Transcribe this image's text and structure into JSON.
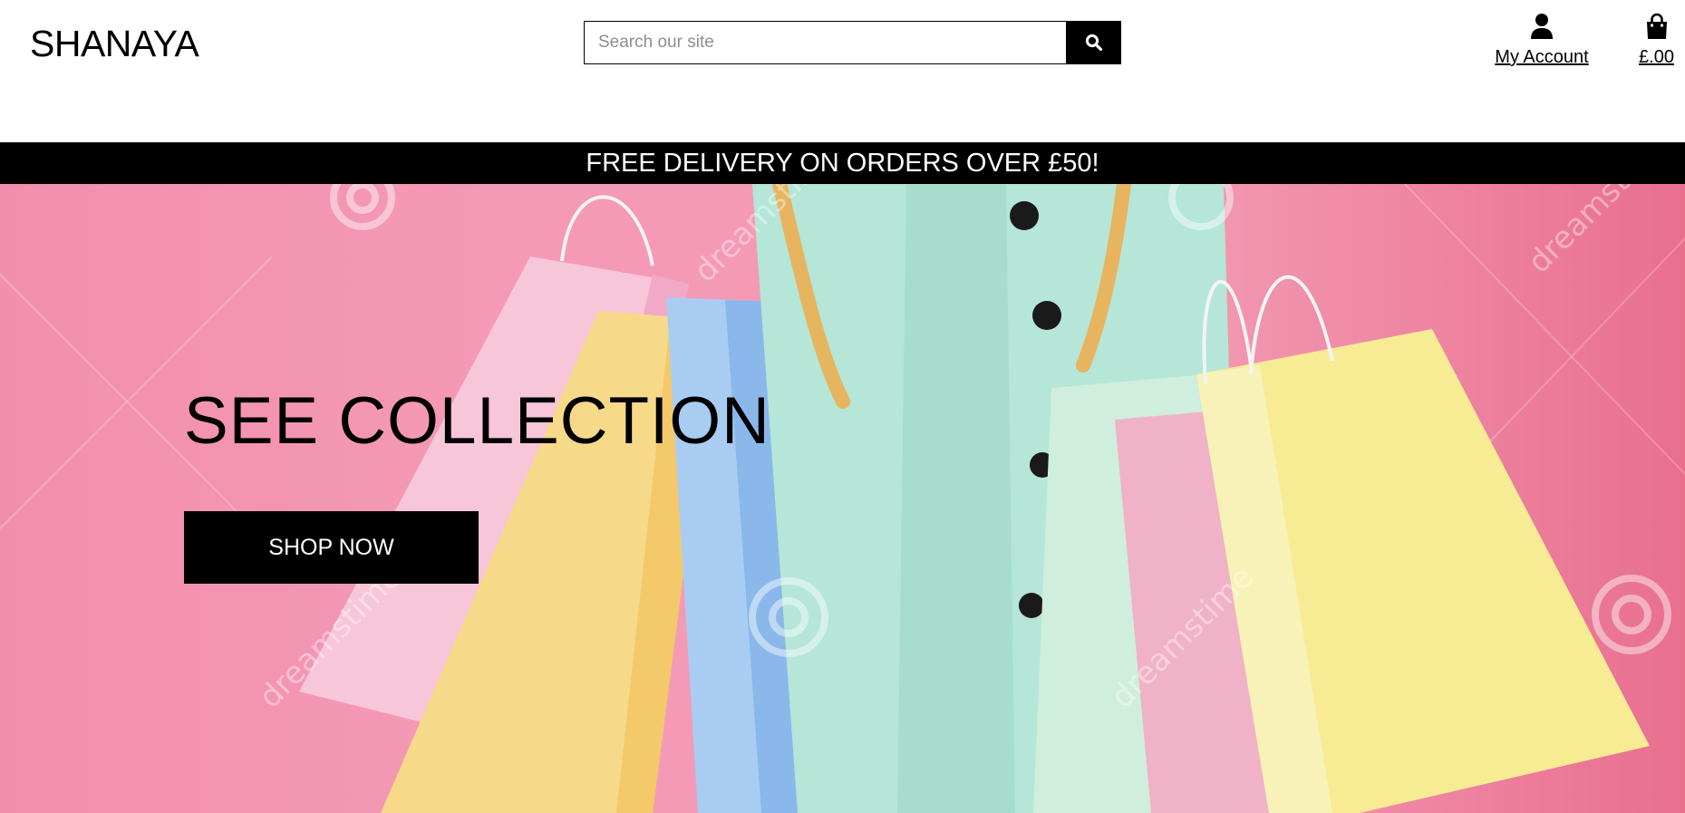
{
  "header": {
    "brand": "SHANAYA",
    "search": {
      "placeholder": "Search our site",
      "value": ""
    },
    "account_label": "My Account",
    "cart_total": "£.00"
  },
  "banner": {
    "text": "FREE DELIVERY ON ORDERS OVER £50!"
  },
  "hero": {
    "title": "SEE COLLECTION",
    "button_label": "SHOP NOW",
    "watermark_text": "dreamstime",
    "background_color": "#f39ab4"
  },
  "icons": [
    "search-icon",
    "user-icon",
    "shopping-bag-icon"
  ]
}
